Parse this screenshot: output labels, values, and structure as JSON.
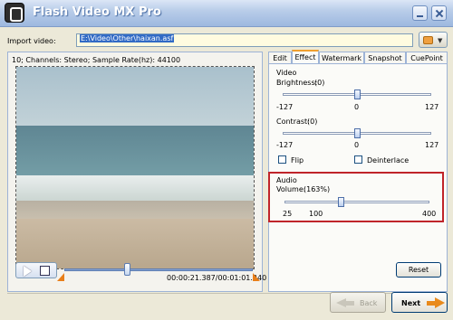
{
  "window": {
    "title": "Flash Video MX Pro"
  },
  "import": {
    "label": "Import video:",
    "value": "E:\\Video\\Other\\haixan.asf"
  },
  "preview": {
    "audio_info": "10; Channels: Stereo; Sample Rate(hz): 44100",
    "timecode": "00:00:21.387/00:01:01.240",
    "seek_position": 0.33
  },
  "tabs": [
    {
      "label": "Edit"
    },
    {
      "label": "Effect",
      "active": true
    },
    {
      "label": "Watermark"
    },
    {
      "label": "Snapshot"
    },
    {
      "label": "CuePoint"
    }
  ],
  "effect": {
    "video_group": "Video",
    "brightness": {
      "label": "Brightness:",
      "value_text": "(0)",
      "min": "-127",
      "mid": "0",
      "max": "127",
      "value": 0
    },
    "contrast": {
      "label": "Contrast:",
      "value_text": "(0)",
      "min": "-127",
      "mid": "0",
      "max": "127",
      "value": 0
    },
    "flip": {
      "label": "Flip",
      "checked": false
    },
    "deinterlace": {
      "label": "Deinterlace",
      "checked": false
    },
    "audio_group": "Audio",
    "volume": {
      "label": "Volume:",
      "value_text": "(163%)",
      "min": "25",
      "mid": "100",
      "max": "400",
      "value": 163
    }
  },
  "buttons": {
    "reset": "Reset",
    "back": "Back",
    "next": "Next"
  },
  "colors": {
    "highlight": "#c0242a",
    "accent_arrow": "#e98a1c"
  }
}
